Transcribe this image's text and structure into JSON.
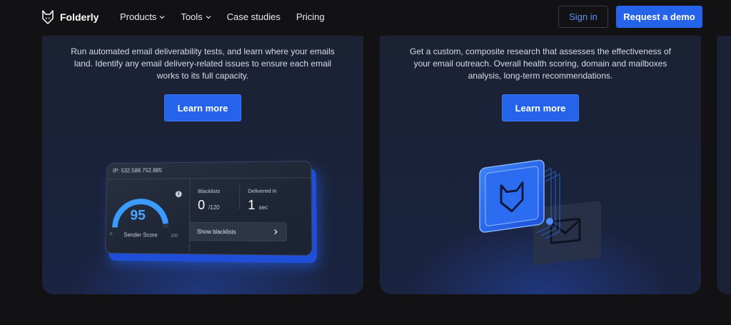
{
  "nav": {
    "logo_text": "Folderly",
    "links": [
      {
        "label": "Products",
        "has_dropdown": true
      },
      {
        "label": "Tools",
        "has_dropdown": true
      },
      {
        "label": "Case studies",
        "has_dropdown": false
      },
      {
        "label": "Pricing",
        "has_dropdown": false
      }
    ],
    "signin_label": "Sign in",
    "demo_label": "Request a demo"
  },
  "cards": [
    {
      "text": "Run automated email deliverability tests, and learn where your emails land. Identify any email delivery-related issues to ensure each email works to its full capacity.",
      "button_label": "Learn more",
      "widget": {
        "ip": "IP: 532.588.752.885",
        "score": "95",
        "score_label": "Sender Score",
        "score_min": "0",
        "score_max": "100",
        "score_fraction": 0.95,
        "blacklists_label": "Blacklists",
        "blacklists_value": "0",
        "blacklists_total": "/120",
        "delivered_label": "Delivered in",
        "delivered_value": "1",
        "delivered_unit": "sec",
        "show_blacklists": "Show blacklists"
      }
    },
    {
      "text": "Get a custom, composite research that assesses the effectiveness of your email outreach. Overall health scoring, domain and mailboxes analysis, long-term recommendations.",
      "button_label": "Learn more"
    }
  ],
  "colors": {
    "accent": "#2563eb",
    "signin_text": "#5d8ff5",
    "gauge": "#3b9cff"
  }
}
